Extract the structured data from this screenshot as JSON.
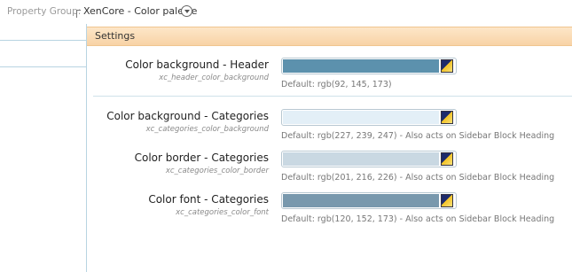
{
  "property_group": {
    "label": "Property Group:",
    "value": "XenCore - Color palette",
    "dropdown_icon": "chevron-down-circle-icon"
  },
  "settings": {
    "header": "Settings",
    "header_color": "#fde3c3"
  },
  "rows": [
    {
      "title": "Color background - Header",
      "var": "xc_header_color_background",
      "color": "#5c91ad",
      "default": "Default: rgb(92, 145, 173)"
    },
    {
      "title": "Color background - Categories",
      "var": "xc_categories_color_background",
      "color": "#e3eff7",
      "default": "Default: rgb(227, 239, 247) - Also acts on Sidebar Block Heading"
    },
    {
      "title": "Color border - Categories",
      "var": "xc_categories_color_border",
      "color": "#c9d8e2",
      "default": "Default: rgb(201, 216, 226) - Also acts on Sidebar Block Heading"
    },
    {
      "title": "Color font - Categories",
      "var": "xc_categories_color_font",
      "color": "#7898ad",
      "default": "Default: rgb(120, 152, 173) - Also acts on Sidebar Block Heading"
    }
  ]
}
